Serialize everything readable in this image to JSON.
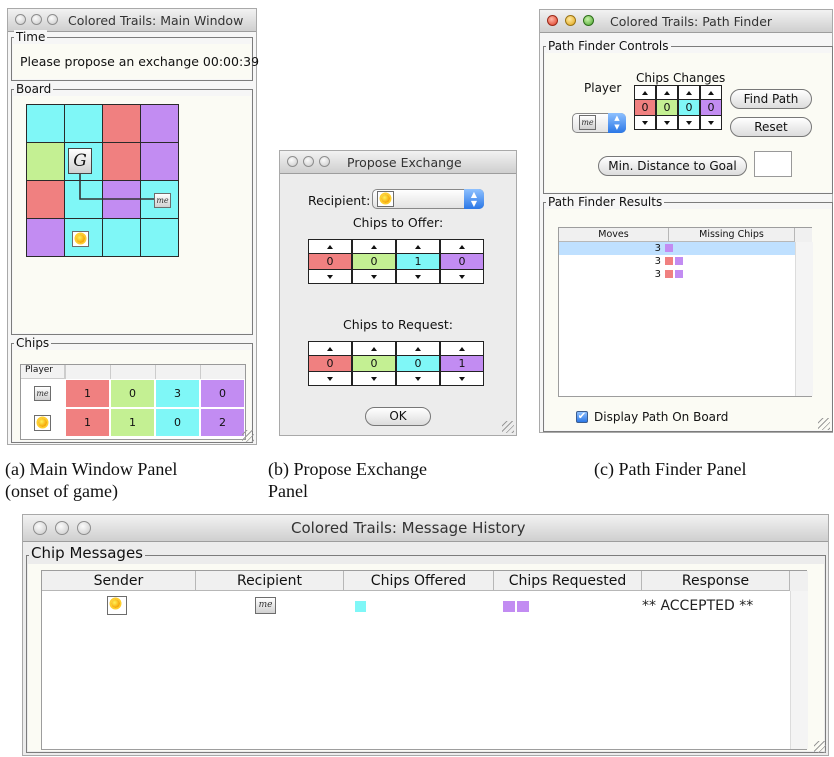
{
  "main_window": {
    "title": "Colored Trails: Main Window",
    "time_label": "Time",
    "status_text": "Please propose an exchange 00:00:39",
    "board_label": "Board",
    "board_colors": [
      [
        "cyan",
        "cyan",
        "red",
        "purple"
      ],
      [
        "green",
        "cyan",
        "red",
        "purple"
      ],
      [
        "red",
        "cyan",
        "purple",
        "cyan"
      ],
      [
        "purple",
        "cyan",
        "cyan",
        "cyan"
      ]
    ],
    "goal_label": "G",
    "me_label": "me",
    "chips_label": "Chips",
    "player_header": "Player",
    "chip_colors": [
      "red",
      "green",
      "cyan",
      "purple"
    ],
    "chip_rows": [
      {
        "player": "me",
        "counts": [
          "1",
          "0",
          "3",
          "0"
        ]
      },
      {
        "player": "sun",
        "counts": [
          "1",
          "1",
          "0",
          "2"
        ]
      }
    ]
  },
  "propose_window": {
    "title": "Propose Exchange",
    "recipient_label": "Recipient:",
    "offer_label": "Chips to Offer:",
    "offer_values": [
      "0",
      "0",
      "1",
      "0"
    ],
    "request_label": "Chips to Request:",
    "request_values": [
      "0",
      "0",
      "0",
      "1"
    ],
    "ok_label": "OK"
  },
  "pathfinder_window": {
    "title": "Colored Trails: Path Finder",
    "controls_label": "Path Finder Controls",
    "player_label": "Player",
    "player_selected": "me",
    "chips_changes_label": "Chips Changes",
    "chips_changes_values": [
      "0",
      "0",
      "0",
      "0"
    ],
    "find_path_label": "Find Path",
    "reset_label": "Reset",
    "min_distance_label": "Min. Distance to Goal",
    "results_label": "Path Finder Results",
    "col_moves": "Moves",
    "col_missing": "Missing Chips",
    "results": [
      {
        "moves": "3",
        "missing": [
          "purple"
        ]
      },
      {
        "moves": "3",
        "missing": [
          "red",
          "purple"
        ]
      },
      {
        "moves": "3",
        "missing": [
          "red",
          "purple"
        ]
      }
    ],
    "display_path_label": "Display Path On Board",
    "display_path_checked": true
  },
  "history_window": {
    "title": "Colored Trails: Message History",
    "group_label": "Chip Messages",
    "columns": [
      "Sender",
      "Recipient",
      "Chips Offered",
      "Chips Requested",
      "Response"
    ],
    "rows": [
      {
        "sender": "sun",
        "recipient": "me",
        "offered": [
          "cyan"
        ],
        "requested": [
          "purple",
          "purple"
        ],
        "response": "** ACCEPTED **"
      }
    ]
  },
  "captions": {
    "a_line1": "(a) Main Window Panel",
    "a_line2": "(onset of game)",
    "b_line1": "(b) Propose Exchange",
    "b_line2": "Panel",
    "c_line1": "(c) Path Finder Panel"
  },
  "colors": {
    "cyan": "#7ff7f7",
    "red": "#f08080",
    "green": "#c4f093",
    "purple": "#c28cf2"
  }
}
